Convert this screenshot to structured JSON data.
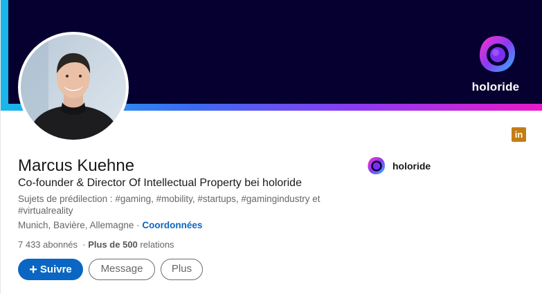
{
  "profile": {
    "name": "Marcus Kuehne",
    "headline": "Co-founder & Director Of Intellectual Property bei holoride",
    "topics": "Sujets de prédilection : #gaming, #mobility, #startups, #gamingindustry et #virtualreality",
    "location": "Munich, Bavière, Allemagne",
    "location_separator": "·",
    "contact_link": "Coordonnées",
    "followers": "7 433 abonnés",
    "stats_separator": "·",
    "connections_bold": "Plus de 500",
    "connections_suffix": "relations"
  },
  "banner": {
    "brand_word": "holoride",
    "colors": {
      "background": "#05002f",
      "gradient_start": "#19b7ea",
      "gradient_end": "#ea1ac9"
    }
  },
  "company": {
    "name": "holoride",
    "logo_icon": "holoride-logo-icon"
  },
  "actions": {
    "follow_label": "Suivre",
    "follow_icon": "plus-icon",
    "message_label": "Message",
    "more_label": "Plus"
  },
  "badges": {
    "linkedin_icon": "linkedin-icon",
    "linkedin_text": "in"
  },
  "colors": {
    "primary_blue": "#0a66c2",
    "linkedin_gold": "#c37d16"
  }
}
